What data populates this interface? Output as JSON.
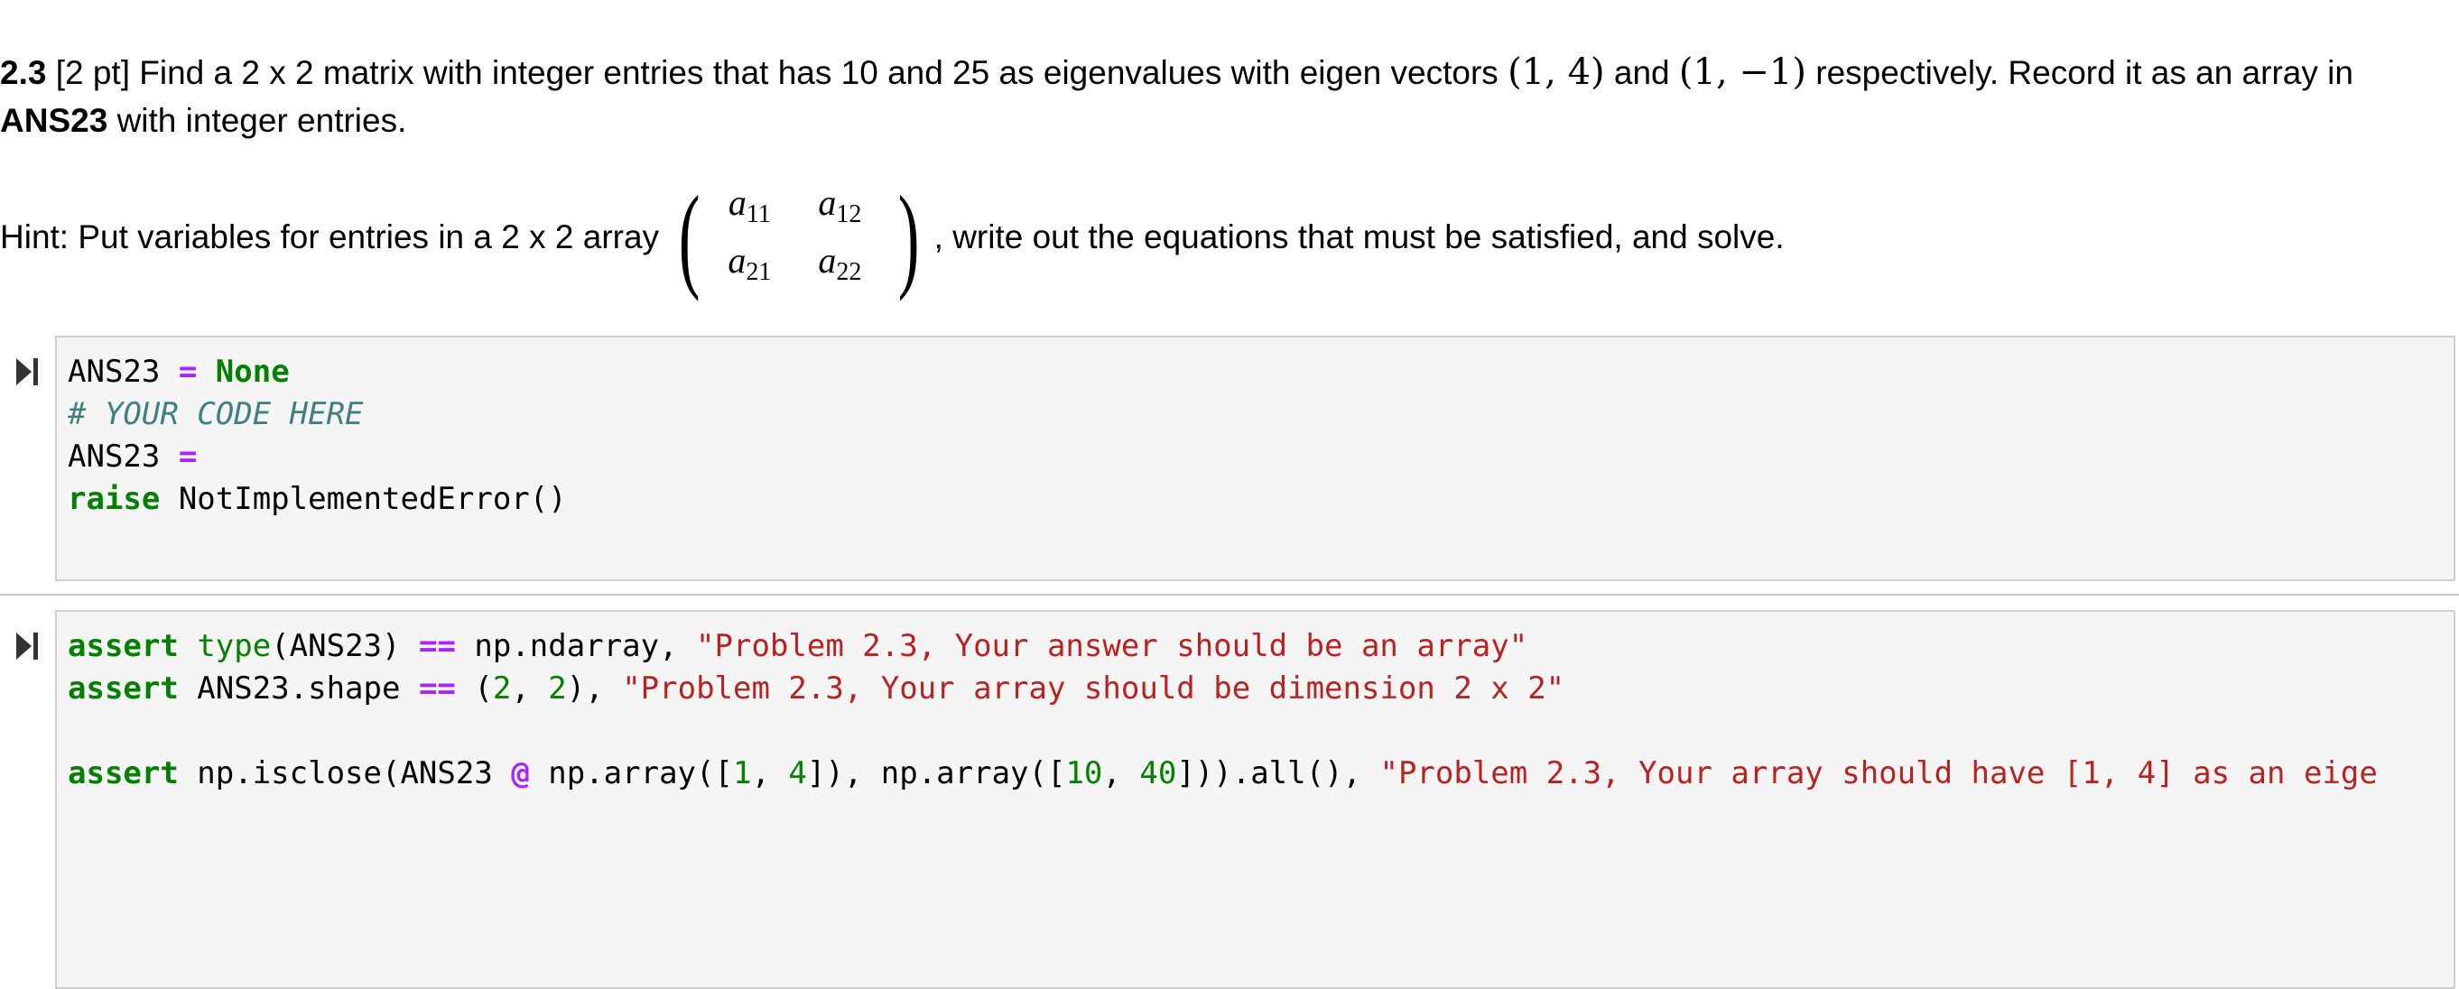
{
  "problem": {
    "number": "2.3",
    "points": "[2 pt]",
    "line1_text": "Find a 2 x 2 matrix with integer entries that has 10 and 25 as eigenvalues with eigen vectors",
    "vector1": "(1, 4)",
    "and": "and",
    "vector2": "(1, −1)",
    "line1_tail": "respectively. Record it as an array in",
    "answer_var": "ANS23",
    "line2_tail": "with integer entries."
  },
  "hint": {
    "lead": "Hint: Put variables for entries in a 2 x 2 array",
    "matrix": {
      "a11": {
        "base": "a",
        "sub": "11"
      },
      "a12": {
        "base": "a",
        "sub": "12"
      },
      "a21": {
        "base": "a",
        "sub": "21"
      },
      "a22": {
        "base": "a",
        "sub": "22"
      }
    },
    "tail": ", write out the equations that must be satisfied, and solve."
  },
  "cell1": {
    "run_icon": "run-cell-icon",
    "lines": [
      [
        {
          "t": "ANS23 ",
          "c": ""
        },
        {
          "t": "=",
          "c": "op"
        },
        {
          "t": " ",
          "c": ""
        },
        {
          "t": "None",
          "c": "kw"
        }
      ],
      [
        {
          "t": "# YOUR CODE HERE",
          "c": "cm"
        }
      ],
      [
        {
          "t": "ANS23 ",
          "c": ""
        },
        {
          "t": "=",
          "c": "op"
        }
      ],
      [
        {
          "t": "raise",
          "c": "kw"
        },
        {
          "t": " NotImplementedError()",
          "c": ""
        }
      ]
    ]
  },
  "cell2": {
    "run_icon": "run-cell-icon",
    "lines": [
      [
        {
          "t": "assert",
          "c": "kw"
        },
        {
          "t": " ",
          "c": ""
        },
        {
          "t": "type",
          "c": "bi"
        },
        {
          "t": "(ANS23) ",
          "c": ""
        },
        {
          "t": "==",
          "c": "op"
        },
        {
          "t": " np.ndarray, ",
          "c": ""
        },
        {
          "t": "\"Problem 2.3, Your answer should be an array\"",
          "c": "st"
        }
      ],
      [
        {
          "t": "assert",
          "c": "kw"
        },
        {
          "t": " ANS23.shape ",
          "c": ""
        },
        {
          "t": "==",
          "c": "op"
        },
        {
          "t": " (",
          "c": ""
        },
        {
          "t": "2",
          "c": "nm"
        },
        {
          "t": ", ",
          "c": ""
        },
        {
          "t": "2",
          "c": "nm"
        },
        {
          "t": "), ",
          "c": ""
        },
        {
          "t": "\"Problem 2.3, Your array should be dimension 2 x 2\"",
          "c": "st"
        }
      ],
      [
        {
          "t": "",
          "c": ""
        }
      ],
      [
        {
          "t": "assert",
          "c": "kw"
        },
        {
          "t": " np.isclose(ANS23 ",
          "c": ""
        },
        {
          "t": "@",
          "c": "op"
        },
        {
          "t": " np.array([",
          "c": ""
        },
        {
          "t": "1",
          "c": "nm"
        },
        {
          "t": ", ",
          "c": ""
        },
        {
          "t": "4",
          "c": "nm"
        },
        {
          "t": "]), np.array([",
          "c": ""
        },
        {
          "t": "10",
          "c": "nm"
        },
        {
          "t": ", ",
          "c": ""
        },
        {
          "t": "40",
          "c": "nm"
        },
        {
          "t": "])).all(), ",
          "c": ""
        },
        {
          "t": "\"Problem 2.3, Your array should have [1, 4] as an eige",
          "c": "st"
        }
      ]
    ]
  }
}
